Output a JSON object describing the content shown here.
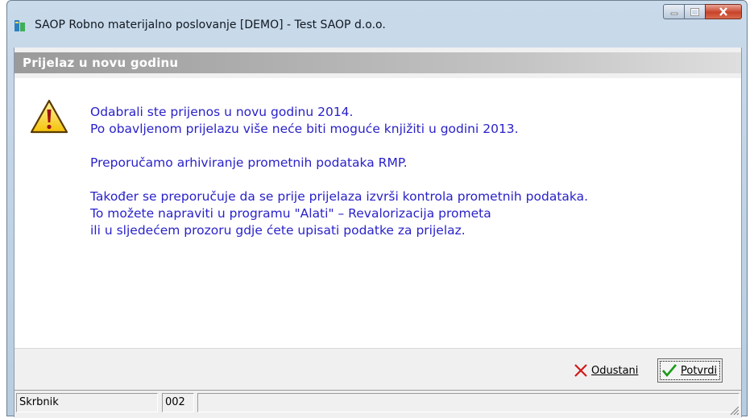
{
  "window": {
    "title": "SAOP Robno materijalno poslovanje [DEMO] - Test SAOP d.o.o."
  },
  "dialog": {
    "header": "Prijelaz u novu godinu",
    "message_lines": [
      "Odabrali ste prijenos u novu godinu 2014.",
      "Po obavljenom prijelazu više neće biti moguće knjižiti u godini 2013.",
      "",
      "Preporučamo arhiviranje prometnih podataka RMP.",
      "",
      "Također se preporučuje da se prije prijelaza izvrši kontrola prometnih podataka.",
      "To možete napraviti u programu \"Alati\" – Revalorizacija prometa",
      "ili u sljedećem prozoru gdje ćete upisati podatke za prijelaz."
    ],
    "cancel_label": "Odustani",
    "confirm_label": "Potvrdi"
  },
  "statusbar": {
    "user": "Skrbnik",
    "code": "002",
    "info": ""
  },
  "colors": {
    "message_text": "#2a22c8",
    "header_bg": "#9a9a9a"
  }
}
